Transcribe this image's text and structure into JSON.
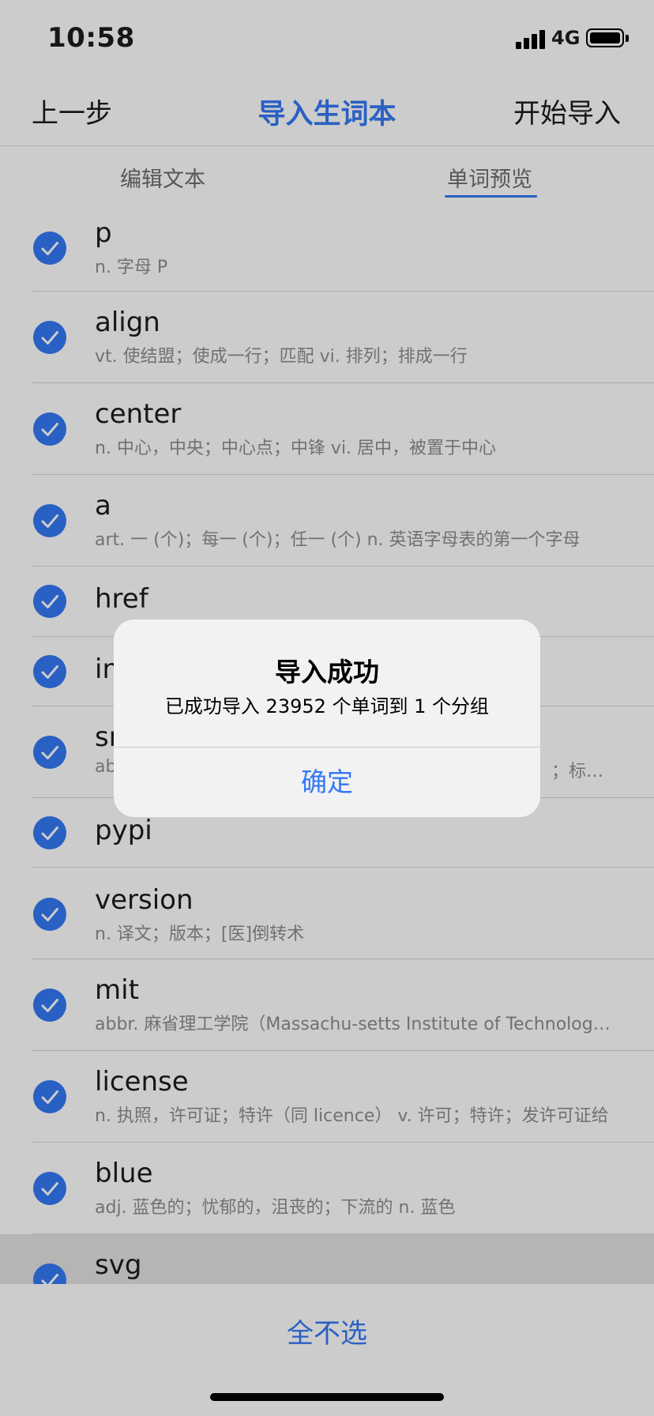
{
  "status_bar": {
    "time": "10:58",
    "network": "4G"
  },
  "nav": {
    "back_label": "上一步",
    "title": "导入生词本",
    "action_label": "开始导入"
  },
  "tabs": [
    {
      "label": "编辑文本"
    },
    {
      "label": "单词预览"
    }
  ],
  "words": [
    {
      "word": "p",
      "definition": "n. 字母 P"
    },
    {
      "word": "align",
      "definition": "vt. 使结盟；使成一行；匹配 vi. 排列；排成一行"
    },
    {
      "word": "center",
      "definition": "n. 中心，中央；中心点；中锋 vi. 居中，被置于中心"
    },
    {
      "word": "a",
      "definition": "art. 一 (个)；每一 (个)；任一 (个) n. 英语字母表的第一个字母"
    },
    {
      "word": "href",
      "definition": ""
    },
    {
      "word": "in",
      "definition": ""
    },
    {
      "word": "sr",
      "definition": "ab",
      "definition_tail": "；标…"
    },
    {
      "word": "pypi",
      "definition": ""
    },
    {
      "word": "version",
      "definition": "n. 译文；版本；[医]倒转术"
    },
    {
      "word": "mit",
      "definition": "abbr. 麻省理工学院（Massachu-setts Institute of Technology）"
    },
    {
      "word": "license",
      "definition": "n. 执照，许可证；特许（同 licence） v. 许可；特许；发许可证给"
    },
    {
      "word": "blue",
      "definition": "adj. 蓝色的；忧郁的，沮丧的；下流的 n. 蓝色"
    },
    {
      "word": "svg",
      "definition": ""
    }
  ],
  "bottom": {
    "select_none_label": "全不选"
  },
  "alert": {
    "title": "导入成功",
    "message": "已成功导入 23952 个单词到 1 个分组",
    "confirm_label": "确定"
  },
  "colors": {
    "accent": "#3478f6",
    "text_primary": "#1c1c1e",
    "text_secondary": "#8e8e93"
  }
}
